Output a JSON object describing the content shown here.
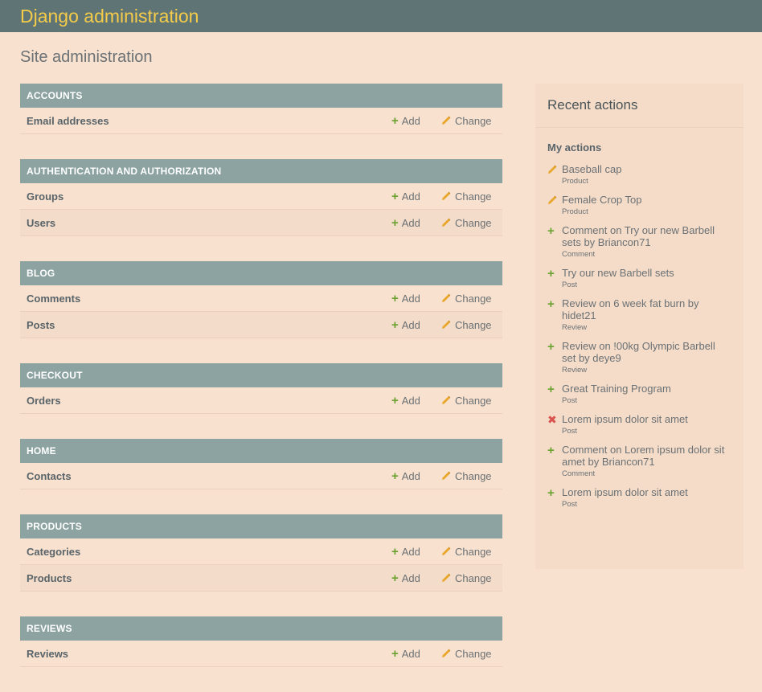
{
  "header": {
    "branding": "Django administration"
  },
  "page": {
    "title": "Site administration"
  },
  "links": {
    "add_label": "Add",
    "change_label": "Change"
  },
  "apps": [
    {
      "name": "Accounts",
      "models": [
        "Email addresses"
      ]
    },
    {
      "name": "Authentication and Authorization",
      "models": [
        "Groups",
        "Users"
      ]
    },
    {
      "name": "Blog",
      "models": [
        "Comments",
        "Posts"
      ]
    },
    {
      "name": "Checkout",
      "models": [
        "Orders"
      ]
    },
    {
      "name": "Home",
      "models": [
        "Contacts"
      ]
    },
    {
      "name": "Products",
      "models": [
        "Categories",
        "Products"
      ]
    },
    {
      "name": "Reviews",
      "models": [
        "Reviews"
      ]
    }
  ],
  "sidebar": {
    "title": "Recent actions",
    "subtitle": "My actions",
    "actions": [
      {
        "icon": "pencil-icon",
        "name": "Baseball cap",
        "type": "Product"
      },
      {
        "icon": "pencil-icon",
        "name": "Female Crop Top",
        "type": "Product"
      },
      {
        "icon": "plus-icon",
        "name": "Comment on Try our new Barbell sets by Briancon71",
        "type": "Comment"
      },
      {
        "icon": "plus-icon",
        "name": "Try our new Barbell sets",
        "type": "Post"
      },
      {
        "icon": "plus-icon",
        "name": "Review on 6 week fat burn by hidet21",
        "type": "Review"
      },
      {
        "icon": "plus-icon",
        "name": "Review on !00kg Olympic Barbell set by deye9",
        "type": "Review"
      },
      {
        "icon": "plus-icon",
        "name": "Great Training Program",
        "type": "Post"
      },
      {
        "icon": "delete-icon",
        "name": "Lorem ipsum dolor sit amet",
        "type": "Post"
      },
      {
        "icon": "plus-icon",
        "name": "Comment on Lorem ipsum dolor sit amet by Briancon71",
        "type": "Comment"
      },
      {
        "icon": "plus-icon",
        "name": "Lorem ipsum dolor sit amet",
        "type": "Post"
      }
    ]
  },
  "colors": {
    "header_bg": "#5f7474",
    "branding": "#f5cb4a",
    "caption_bg": "#8ca3a1",
    "page_bg": "#f8e1ce",
    "add_green": "#6aa130",
    "change_yellow": "#e8a72a",
    "delete_red": "#d9534f"
  }
}
